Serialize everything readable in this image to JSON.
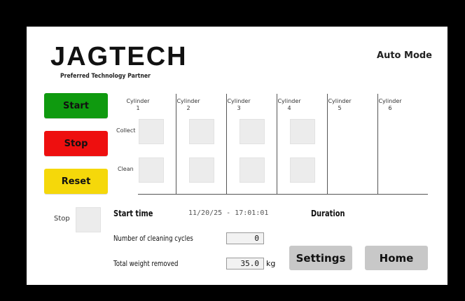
{
  "header": {
    "logo": "JAGTECH",
    "tagline": "Preferred Technology Partner",
    "mode": "Auto Mode"
  },
  "controls": {
    "start_label": "Start",
    "stop_label": "Stop",
    "reset_label": "Reset",
    "start_color": "#0f9a0f",
    "stop_color": "#ee0f0f",
    "reset_color": "#f5d80a"
  },
  "status": {
    "label": "Stop"
  },
  "cylinders": [
    {
      "name": "Cylinder",
      "number": "1"
    },
    {
      "name": "Cylinder",
      "number": "2"
    },
    {
      "name": "Cylinder",
      "number": "3"
    },
    {
      "name": "Cylinder",
      "number": "4"
    },
    {
      "name": "Cylinder",
      "number": "5"
    },
    {
      "name": "Cylinder",
      "number": "6"
    }
  ],
  "rows": {
    "collect_label": "Collect",
    "clean_label": "Clean"
  },
  "info": {
    "start_time_label": "Start time",
    "start_time_value": "11/20/25 - 17:01:01",
    "duration_label": "Duration",
    "cycles_label": "Number of cleaning cycles",
    "cycles_value": "0",
    "weight_label": "Total weight removed",
    "weight_value": "35.0",
    "weight_unit": "kg"
  },
  "nav": {
    "settings_label": "Settings",
    "home_label": "Home"
  }
}
